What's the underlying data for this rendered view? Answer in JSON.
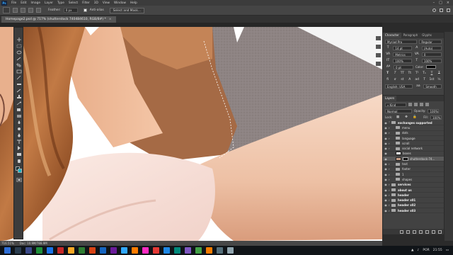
{
  "menubar": {
    "items": [
      "File",
      "Edit",
      "Image",
      "Layer",
      "Type",
      "Select",
      "Filter",
      "3D",
      "View",
      "Window",
      "Help"
    ]
  },
  "options": {
    "feather_label": "Feather:",
    "feather_value": "0 px",
    "antialias_label": "Anti-alias",
    "select_mask_label": "Select and Mask..."
  },
  "document": {
    "tab_title": "Homepage2.psd @ 717% (shutterstock 740484610, RGB/8#) *"
  },
  "status": {
    "zoom": "716.51%",
    "doc_size": "Doc: 10.9M/788.9M"
  },
  "character": {
    "tabs": [
      "Character",
      "Paragraph",
      "Glyphs"
    ],
    "font_family": "Myriad Pro",
    "font_style": "Regular",
    "size": "14 pt",
    "leading": "(Auto)",
    "kerning": "Metrics",
    "tracking": "0",
    "vscale": "100%",
    "hscale": "100%",
    "baseline": "0 pt",
    "color_label": "Color:",
    "style_buttons": [
      "T",
      "T",
      "TT",
      "Tt",
      "T¹",
      "T₁",
      "T",
      "T"
    ],
    "ot_buttons": [
      "fi",
      "ơ",
      "st",
      "A",
      "ad",
      "T",
      "1st",
      "½"
    ],
    "language": "English: USA",
    "aa_icon": "aa",
    "aa_mode": "Smooth"
  },
  "layers": {
    "title": "Layers",
    "kind_label": "Kind",
    "blend_mode": "Normal",
    "opacity_label": "Opacity:",
    "opacity_value": "100%",
    "lock_label": "Lock:",
    "fill_label": "Fill:",
    "fill_value": "100%",
    "rows": [
      {
        "name": "exchanges supported",
        "type": "group-open",
        "indent": 0,
        "bold": true
      },
      {
        "name": "menu",
        "type": "group",
        "indent": 1
      },
      {
        "name": "dots",
        "type": "group",
        "indent": 1
      },
      {
        "name": "language",
        "type": "group",
        "indent": 1
      },
      {
        "name": "scroll",
        "type": "group",
        "indent": 1
      },
      {
        "name": "social network",
        "type": "group",
        "indent": 1
      },
      {
        "name": "boxes",
        "type": "image",
        "indent": 1
      },
      {
        "name": "shutterstock-74...",
        "type": "masked",
        "indent": 1,
        "selected": true
      },
      {
        "name": "text",
        "type": "group",
        "indent": 1
      },
      {
        "name": "footer",
        "type": "group",
        "indent": 1
      },
      {
        "name": "1",
        "type": "group",
        "indent": 1
      },
      {
        "name": "shapes",
        "type": "group",
        "indent": 1
      },
      {
        "name": "services",
        "type": "group",
        "indent": 0,
        "bold": true
      },
      {
        "name": "about us",
        "type": "group",
        "indent": 0,
        "bold": true
      },
      {
        "name": "header",
        "type": "group",
        "indent": 0,
        "bold": true
      },
      {
        "name": "header s01",
        "type": "group",
        "indent": 0,
        "bold": true
      },
      {
        "name": "header s02",
        "type": "group",
        "indent": 0,
        "bold": true
      },
      {
        "name": "header s03",
        "type": "group",
        "indent": 0,
        "bold": true
      }
    ]
  },
  "taskbar": {
    "lang": "POR",
    "time": "21:55",
    "icon_colors": [
      "#2b3d4f",
      "#3b4a8a",
      "#1f8f3a",
      "#1a73e8",
      "#c62828",
      "#f9a825",
      "#2e7d32",
      "#d84315",
      "#1565c0",
      "#6a1b9a",
      "#31a8ff",
      "#ff7c00",
      "#ff2bc2",
      "#e53935",
      "#1e88e5",
      "#00897b",
      "#7e57c2",
      "#43a047",
      "#f57c00",
      "#546e7a",
      "#90a4ae"
    ]
  },
  "colors": {
    "accent": "#31a8ff",
    "foreground_color": "#0d2a2d",
    "background_color": "#14b7c6"
  }
}
